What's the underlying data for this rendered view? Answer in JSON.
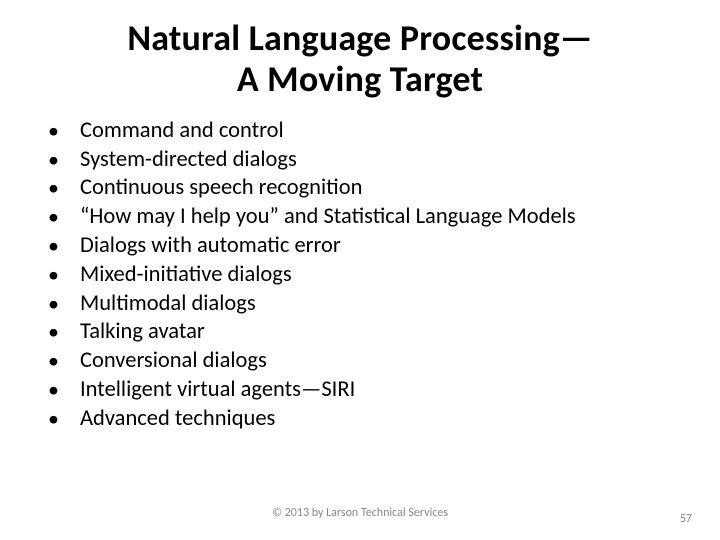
{
  "title_line1": "Natural Language Processing—",
  "title_line2": "A Moving Target",
  "bullets": [
    "Command and control",
    "System-directed dialogs",
    "Continuous speech recognition",
    "“How may I help you” and Statistical Language Models",
    "Dialogs with automatic error",
    "Mixed-initiative dialogs",
    "Multimodal dialogs",
    "Talking avatar",
    "Conversional dialogs",
    "Intelligent virtual agents—SIRI",
    "Advanced techniques"
  ],
  "copyright": "© 2013 by Larson Technical Services",
  "page_number": "57"
}
